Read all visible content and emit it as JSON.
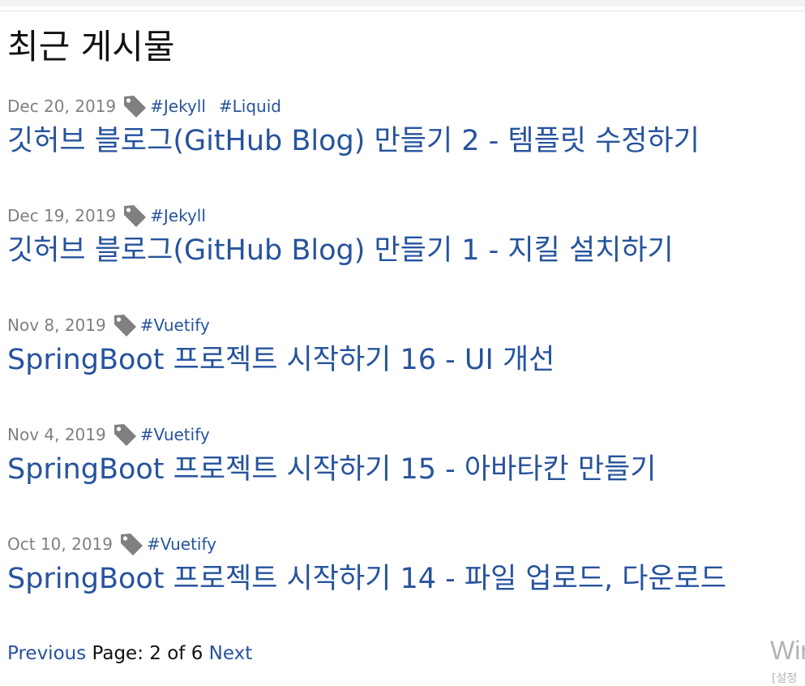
{
  "page": {
    "heading": "최근 게시물"
  },
  "posts": [
    {
      "date": "Dec 20, 2019",
      "tags": [
        "#Jekyll",
        "#Liquid"
      ],
      "title": "깃허브 블로그(GitHub Blog) 만들기 2 - 템플릿 수정하기"
    },
    {
      "date": "Dec 19, 2019",
      "tags": [
        "#Jekyll"
      ],
      "title": "깃허브 블로그(GitHub Blog) 만들기 1 - 지킬 설치하기"
    },
    {
      "date": "Nov 8, 2019",
      "tags": [
        "#Vuetify"
      ],
      "title": "SpringBoot 프로젝트 시작하기 16 - UI 개선"
    },
    {
      "date": "Nov 4, 2019",
      "tags": [
        "#Vuetify"
      ],
      "title": "SpringBoot 프로젝트 시작하기 15 - 아바타칸 만들기"
    },
    {
      "date": "Oct 10, 2019",
      "tags": [
        "#Vuetify"
      ],
      "title": "SpringBoot 프로젝트 시작하기 14 - 파일 업로드, 다운로드"
    }
  ],
  "pagination": {
    "previous_label": "Previous",
    "page_prefix": "Page:",
    "current_page": "2",
    "of_label": "of",
    "total_pages": "6",
    "next_label": "Next"
  },
  "watermark": {
    "line1": "Win",
    "line2": "[설정"
  },
  "icons": {
    "tag": "tag-icon"
  },
  "colors": {
    "link": "#26539d",
    "muted": "#808080",
    "tag_icon": "#808080"
  }
}
